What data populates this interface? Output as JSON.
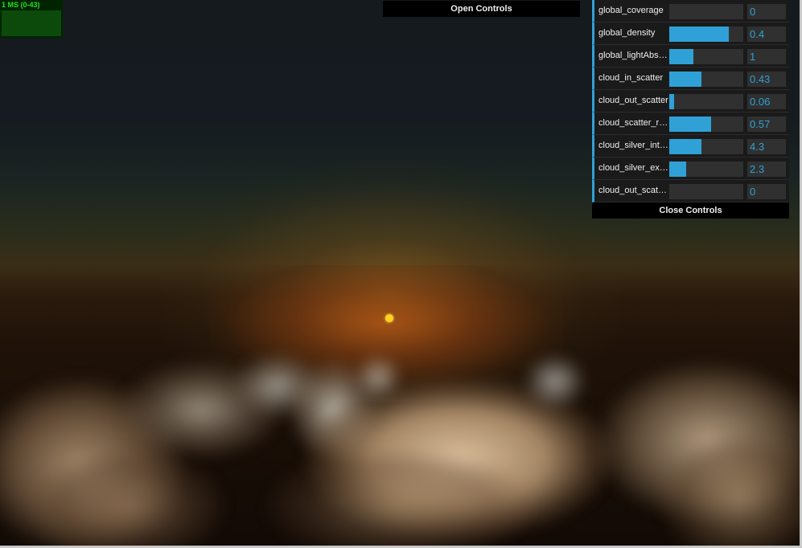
{
  "stats": {
    "label": "1 MS (0-43)"
  },
  "open_controls_label": "Open Controls",
  "close_controls_label": "Close Controls",
  "controls": [
    {
      "label": "global_coverage",
      "value": "0",
      "fraction": 0.0
    },
    {
      "label": "global_density",
      "value": "0.4",
      "fraction": 0.8
    },
    {
      "label": "global_lightAbsorption",
      "value": "1",
      "fraction": 0.33
    },
    {
      "label": "cloud_in_scatter",
      "value": "0.43",
      "fraction": 0.43
    },
    {
      "label": "cloud_out_scatter",
      "value": "0.06",
      "fraction": 0.06
    },
    {
      "label": "cloud_scatter_ratio",
      "value": "0.57",
      "fraction": 0.57
    },
    {
      "label": "cloud_silver_intensity",
      "value": "4.3",
      "fraction": 0.43
    },
    {
      "label": "cloud_silver_exponent",
      "value": "2.3",
      "fraction": 0.23
    },
    {
      "label": "cloud_out_scatter_ambient",
      "value": "0",
      "fraction": 0.0
    }
  ],
  "colors": {
    "accent": "#2fa1d6",
    "sun": "#ffd21a",
    "stats_text": "#22dd22"
  }
}
